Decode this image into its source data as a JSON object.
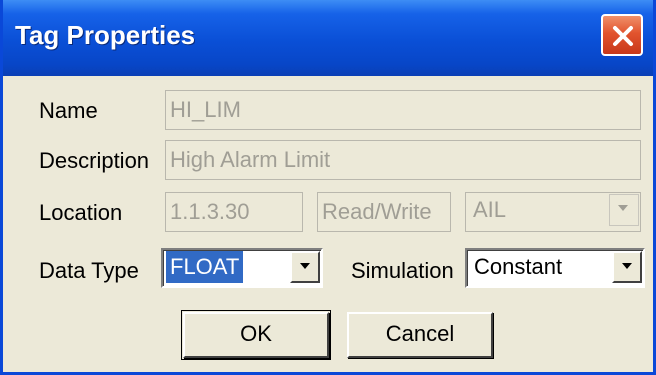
{
  "window": {
    "title": "Tag Properties"
  },
  "fields": {
    "name_label": "Name",
    "name_value": "HI_LIM",
    "description_label": "Description",
    "description_value": "High Alarm Limit",
    "location_label": "Location",
    "location_address": "1.1.3.30",
    "location_access": "Read/Write",
    "location_type": "AIL",
    "data_type_label": "Data Type",
    "data_type_value": "FLOAT",
    "simulation_label": "Simulation",
    "simulation_value": "Constant"
  },
  "buttons": {
    "ok": "OK",
    "cancel": "Cancel"
  },
  "icons": {
    "close": "close-icon",
    "dropdown": "chevron-down-icon"
  },
  "colors": {
    "titlebar": "#0a4fd6",
    "close_button": "#e2542e",
    "dialog_bg": "#ece9d8",
    "selection": "#316ac5"
  }
}
